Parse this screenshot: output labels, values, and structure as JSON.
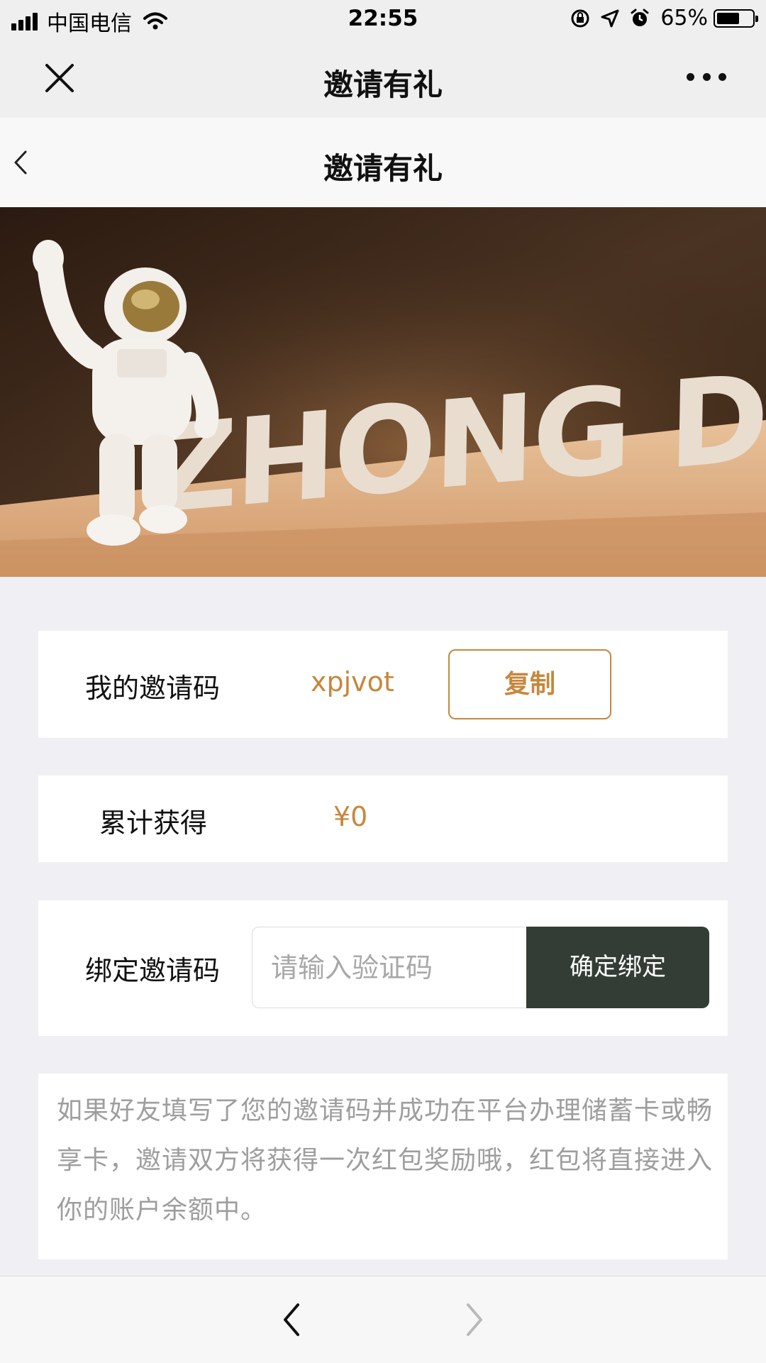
{
  "status_bar": {
    "carrier": "中国电信",
    "time": "22:55",
    "battery_percent": "65%",
    "battery_level": 0.65
  },
  "wechat_bar": {
    "title": "邀请有礼",
    "close_icon": "close-icon",
    "more_icon": "more-icon"
  },
  "page_header": {
    "title": "邀请有礼",
    "back_icon": "chevron-left-icon"
  },
  "banner": {
    "logo_text": "ZHONG DU"
  },
  "my_code": {
    "label": "我的邀请码",
    "code": "xpjvot",
    "copy_label": "复制"
  },
  "earnings": {
    "label": "累计获得",
    "amount": "¥0"
  },
  "bind_code": {
    "label": "绑定邀请码",
    "placeholder": "请输入验证码",
    "value": "",
    "button_label": "确定绑定"
  },
  "description": "如果好友填写了您的邀请码并成功在平台办理储蓄卡或畅享卡，邀请双方将获得一次红包奖励哦，红包将直接进入你的账户余额中。",
  "colors": {
    "accent": "#c7873d",
    "dark_button": "#333d35",
    "background": "#efeff4"
  },
  "bottom_nav": {
    "back_icon": "chevron-left-icon",
    "forward_icon": "chevron-right-icon",
    "forward_enabled": false
  }
}
